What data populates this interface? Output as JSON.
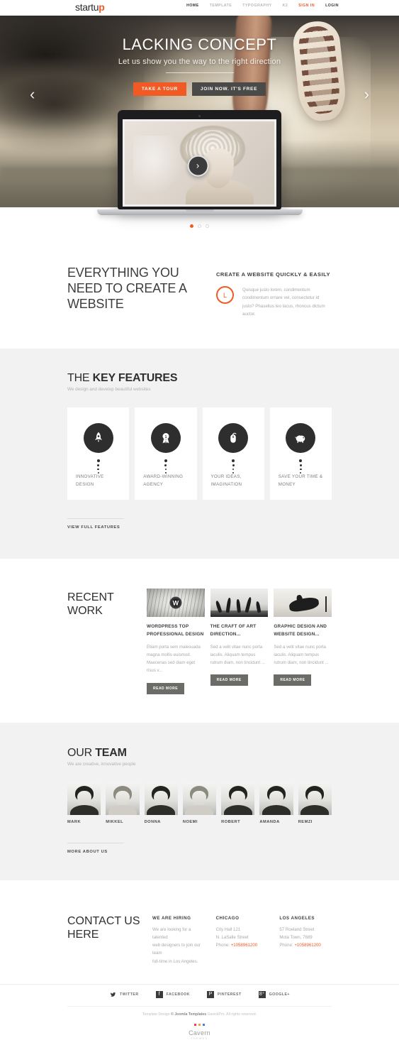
{
  "header": {
    "logo_text": "startu",
    "logo_accent": "p",
    "nav": [
      {
        "label": "HOME",
        "state": "active"
      },
      {
        "label": "TEMPLATE",
        "state": "normal"
      },
      {
        "label": "TYPOGRAPHY",
        "state": "normal"
      },
      {
        "label": "K2",
        "state": "normal"
      },
      {
        "label": "SIGN IN",
        "state": "accent"
      },
      {
        "label": "LOGIN",
        "state": "dark"
      }
    ]
  },
  "hero": {
    "title": "LACKING CONCEPT",
    "subtitle": "Let us show you the way to the right direction",
    "btn_tour": "TAKE A TOUR",
    "btn_join": "JOIN NOW. IT'S FREE",
    "arrow_prev": "‹",
    "arrow_next": "›",
    "play_glyph": "›",
    "accent_color": "#f15a24",
    "dark_button_color": "#4a4a48",
    "slides_total": 3,
    "slide_active": 1
  },
  "intro": {
    "heading": "EVERYTHING YOU NEED TO CREATE A WEBSITE",
    "subheading": "CREATE A WEBSITE QUICKLY & EASILY",
    "icon_glyph": "L",
    "body": "Quisque justo lorem, condimentum condimentum ornare vel, consectetur id justo? Phasellus leo lacus, rhoncus dictum auctor."
  },
  "features": {
    "title_light": "THE ",
    "title_bold": "KEY FEATURES",
    "subtitle": "We design and develop beautiful websites",
    "cards": [
      {
        "icon": "rocket-icon",
        "glyph": "Ὠ0",
        "label": "INNOVATIVE DESIGN"
      },
      {
        "icon": "award-ribbon-icon",
        "glyph": "★",
        "label": "AWARD-WINNING AGENCY"
      },
      {
        "icon": "mouse-icon",
        "glyph": "⌘",
        "label": "YOUR IDEAS, IMAGINATION"
      },
      {
        "icon": "piggy-bank-icon",
        "glyph": "◔",
        "label": "SAVE YOUR TIME & MONEY"
      }
    ],
    "more_link": "VIEW FULL FEATURES"
  },
  "work": {
    "title": "RECENT WORK",
    "items": [
      {
        "thumb": "wordpress-eye-thumbnail",
        "title": "WORDPRESS TOP PROFESSIONAL DESIGN",
        "excerpt": "Etiam porta sem malesuada magna mollis euismod. Maecenas sed diam eget risus v...",
        "button": "READ MORE"
      },
      {
        "thumb": "art-direction-thumbnail",
        "title": "THE CRAFT OF ART DIRECTION...",
        "excerpt": "Sed a velit vitae nunc porta iaculis. Aliquam tempus rutrum diam, non tincidunt ...",
        "button": "READ MORE"
      },
      {
        "thumb": "graphic-design-thumbnail",
        "title": "GRAPHIC DESIGN AND WEBSITE DESIGN...",
        "excerpt": "Sed a velit vitae nunc porta iaculis. Aliquam tempus rutrum diam, non tincidunt ...",
        "button": "READ MORE"
      }
    ]
  },
  "team": {
    "title_light": "OUR ",
    "title_bold": "TEAM",
    "subtitle": "We are creative, innovative people",
    "members": [
      {
        "name": "MARK",
        "tone": "dark"
      },
      {
        "name": "MIKKEL",
        "tone": "light"
      },
      {
        "name": "DONNA",
        "tone": "dark"
      },
      {
        "name": "NOEMI",
        "tone": "light"
      },
      {
        "name": "ROBERT",
        "tone": "dark"
      },
      {
        "name": "AMANDA",
        "tone": "dark"
      },
      {
        "name": "REMZI",
        "tone": "dark"
      }
    ],
    "more_link": "MORE ABOUT US"
  },
  "contact": {
    "title": "CONTACT US HERE",
    "columns": [
      {
        "heading": "WE ARE HIRING",
        "lines": [
          "We are looking for a talented",
          "web designers to join our team",
          "full-time in Los Angeles."
        ],
        "phone_label": "",
        "phone": ""
      },
      {
        "heading": "CHICAGO",
        "lines": [
          "City Hall 121",
          "N. LaSalle Street"
        ],
        "phone_label": "Phone: ",
        "phone": "+1058961200"
      },
      {
        "heading": "LOS ANGELES",
        "lines": [
          "57 Roeland Street",
          "Mota Town, 7689"
        ],
        "phone_label": "Phone: ",
        "phone": "+1058961200"
      }
    ]
  },
  "footer": {
    "social": [
      {
        "icon": "twitter-icon",
        "glyph": "ᵔ",
        "label": "TWITTER"
      },
      {
        "icon": "facebook-icon",
        "glyph": "f",
        "label": "FACEBOOK"
      },
      {
        "icon": "pinterest-icon",
        "glyph": "P",
        "label": "PINTEREST"
      },
      {
        "icon": "googleplus-icon",
        "glyph": "8⁺",
        "label": "GOOGLE+"
      }
    ],
    "copyright_pre": "Template Design ",
    "copyright_link": "© Joomla Templates",
    "copyright_post": " GavickPro. All rights reserved.",
    "brand_name": "Cavern",
    "brand_tagline": "THEMES",
    "brand_dot_colors": [
      "#e8453c",
      "#f2a93b",
      "#4a7fd6"
    ]
  }
}
